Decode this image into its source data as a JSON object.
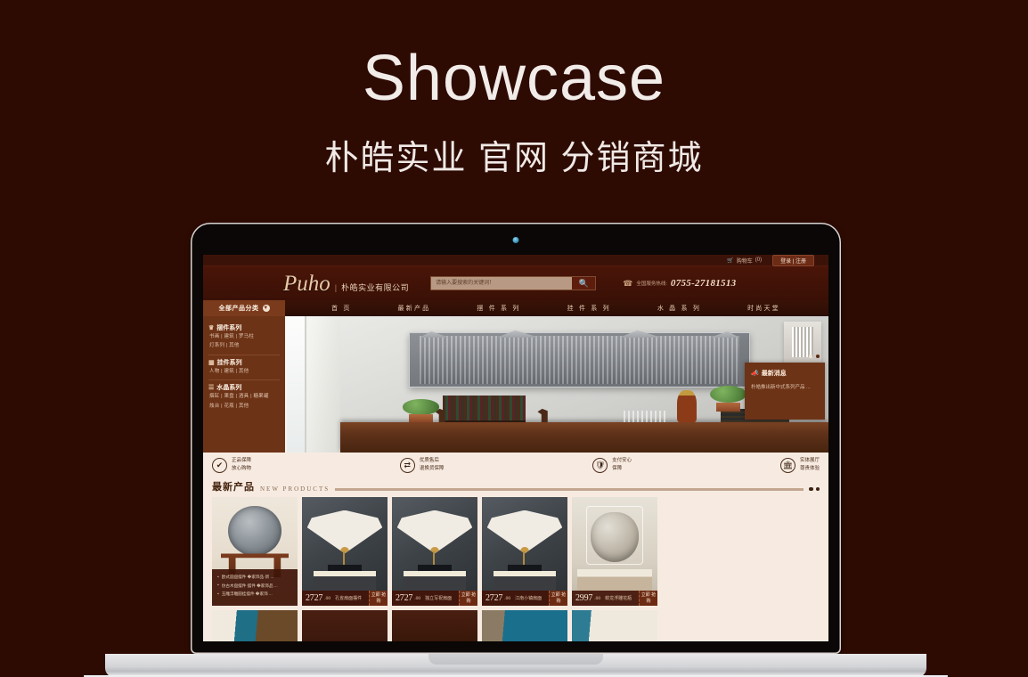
{
  "hero": {
    "title": "Showcase",
    "subtitle": "朴皓实业 官网 分销商城"
  },
  "colors": {
    "background": "#2e0b02",
    "brand_brown": "#6d3317",
    "nav_active": "#7a3a1c",
    "page_cream": "#f7ebe1",
    "accent_gold": "#e6c9a8"
  },
  "site": {
    "topbar": {
      "cart_icon": "cart-icon",
      "cart_label": "购物车",
      "cart_count": "(0)",
      "login_label": "登录 | 注册"
    },
    "header": {
      "logo_mark": "Puho",
      "logo_divider": "|",
      "logo_text": "朴皓实业有限公司",
      "search_placeholder": "请输入要搜索的关键词！",
      "search_value": "",
      "search_icon": "search-icon",
      "phone_icon": "phone-icon",
      "phone_label": "全国服务热线:",
      "phone_number": "0755-27181513"
    },
    "nav": {
      "categories_label": "全部产品分类",
      "categories_icon": "chevron-down-icon",
      "items": [
        {
          "label": "首 页"
        },
        {
          "label": "最新产品"
        },
        {
          "label": "摆 件 系 列"
        },
        {
          "label": "挂 件 系 列"
        },
        {
          "label": "水 晶 系 列"
        },
        {
          "label": "时尚天堂"
        }
      ]
    },
    "sidebar": {
      "groups": [
        {
          "icon": "statue-icon",
          "title": "摆件系列",
          "links": [
            "书画 | 建筑 | 罗马柱",
            "灯系列 | 其他"
          ]
        },
        {
          "icon": "frame-icon",
          "title": "挂件系列",
          "links": [
            "人物 | 建筑 | 其他"
          ]
        },
        {
          "icon": "crystal-icon",
          "title": "水晶系列",
          "links": [
            "烟缸 | 果盘 | 酒具 | 糖果罐",
            "烛台 | 花瓶 | 其他"
          ]
        }
      ]
    },
    "news": {
      "icon": "megaphone-icon",
      "title": "最新消息",
      "text": "朴皓推出新中式系列产品 ..."
    },
    "services": [
      {
        "icon": "check-circle-icon",
        "line1": "正品保障",
        "line2": "放心购物"
      },
      {
        "icon": "exchange-icon",
        "line1": "优质售后",
        "line2": "退换货保障"
      },
      {
        "icon": "shield-icon",
        "line1": "支付安心",
        "line2": "保障"
      },
      {
        "icon": "bank-icon",
        "line1": "实体展厅",
        "line2": "尊贵体验"
      }
    ],
    "section": {
      "title_cn": "最新产品",
      "title_en": "NEW  PRODUCTS",
      "pager_icon": "carousel-dots-icon"
    },
    "products": [
      {
        "kind": "bullets",
        "bullets": [
          "欧式圆盘摆件 �家饰品·新 ...",
          "仿古木盘摆件 摆件 �家饰品 ...",
          "玉雕浮雕圆挂摆件 �家饰 ..."
        ]
      },
      {
        "kind": "priced",
        "price": "2727",
        "decimals": ".00",
        "name": "孔雀扇面摆件",
        "buy_label": "立即\n抢购"
      },
      {
        "kind": "priced",
        "price": "2727",
        "decimals": ".00",
        "name": "独立写祝扇面",
        "buy_label": "立即\n抢购"
      },
      {
        "kind": "priced",
        "price": "2727",
        "decimals": ".00",
        "name": "江南小镇扇面",
        "buy_label": "立即\n抢购"
      },
      {
        "kind": "priced",
        "price": "2997",
        "decimals": ".00",
        "name": "蛟龙浮雕花瓶",
        "buy_label": "立即\n抢购"
      }
    ]
  },
  "device": {
    "name": "laptop-mockup",
    "camera_icon": "camera-dot-icon"
  }
}
